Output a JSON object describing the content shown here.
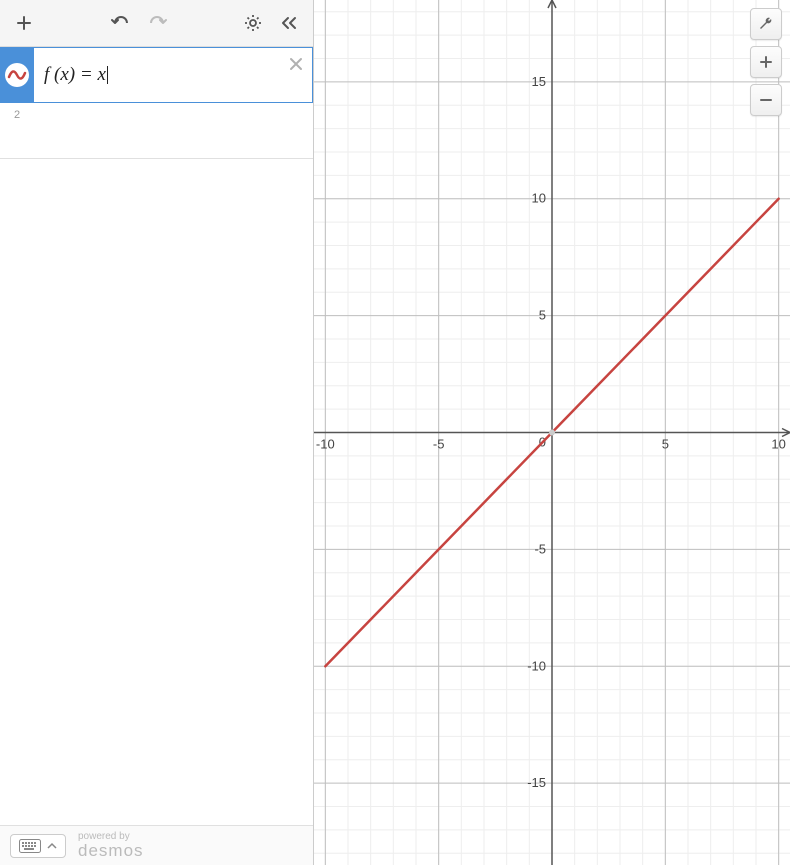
{
  "toolbar": {
    "add_label": "+",
    "undo_label": "↶",
    "redo_label": "↷",
    "settings_label": "⚙",
    "collapse_label": "«"
  },
  "expressions": [
    {
      "index": "1",
      "formula_display": "f (x) = x",
      "color": "#c74440"
    }
  ],
  "next_index": "2",
  "footer": {
    "keyboard_label": "⌨",
    "keyboard_arrow": "▲",
    "powered_by": "powered by",
    "brand": "desmos"
  },
  "graph_controls": {
    "wrench": "🔧",
    "zoom_in": "+",
    "zoom_out": "−"
  },
  "chart_data": {
    "type": "line",
    "title": "",
    "xlabel": "",
    "ylabel": "",
    "xlim": [
      -10.5,
      10.5
    ],
    "ylim": [
      -18.5,
      18.5
    ],
    "x_ticks": [
      -10,
      -5,
      0,
      5,
      10
    ],
    "y_ticks": [
      -15,
      -10,
      -5,
      0,
      5,
      10,
      15
    ],
    "minor_grid_step": 1,
    "series": [
      {
        "name": "f(x)=x",
        "color": "#c74440",
        "x": [
          -10,
          -5,
          0,
          5,
          10
        ],
        "y": [
          -10,
          -5,
          0,
          5,
          10
        ]
      }
    ]
  }
}
